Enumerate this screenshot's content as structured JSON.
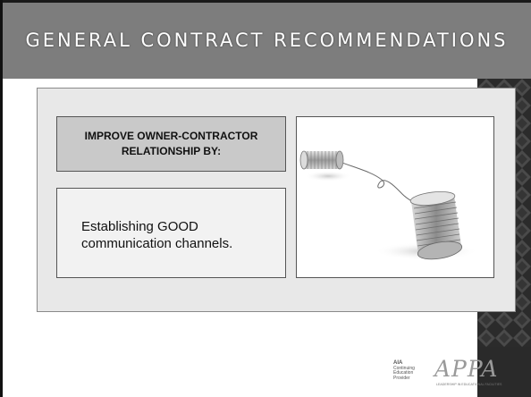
{
  "slide": {
    "title": "GENERAL CONTRACT RECOMMENDATIONS",
    "heading_box": {
      "text": "IMPROVE OWNER-CONTRACTOR RELATIONSHIP BY:"
    },
    "body_box": {
      "text": "Establishing GOOD communication channels."
    },
    "image": {
      "icon": "tin-can-telephone-icon"
    },
    "logos": {
      "aia": {
        "line1": "AIA",
        "line2": "Continuing",
        "line3": "Education",
        "line4": "Provider"
      },
      "appa": {
        "wordmark": "APPA",
        "tagline": "LEADERSHIP IN EDUCATIONAL FACILITIES"
      }
    }
  },
  "colors": {
    "header_bg": "#7d7d7d",
    "panel_bg": "#e8e8e8",
    "heading_box_bg": "#c9c9c9",
    "body_box_bg": "#f2f2f2",
    "dark_edge": "#2a2a2a"
  }
}
